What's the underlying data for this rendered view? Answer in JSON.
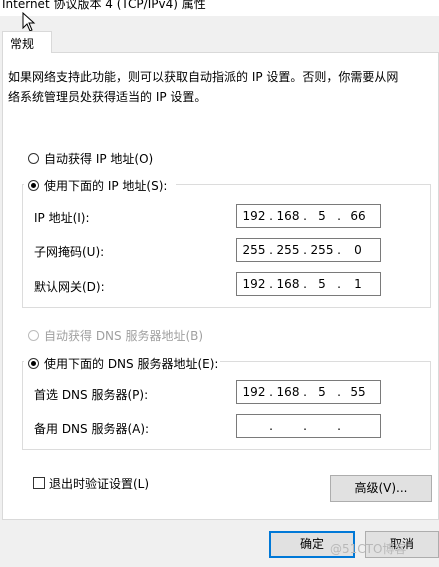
{
  "window": {
    "title": "Internet 协议版本 4 (TCP/IPv4) 属性"
  },
  "tabs": [
    {
      "label": "常规"
    }
  ],
  "description": "如果网络支持此功能，则可以获取自动指派的 IP 设置。否则，你需要从网\n络系统管理员处获得适当的 IP 设置。",
  "ip_section": {
    "auto_label": "自动获得 IP 地址(O)",
    "manual_label": "使用下面的 IP 地址(S):",
    "selected": "manual",
    "fields": [
      {
        "label": "IP 地址(I):",
        "octets": [
          "192",
          "168",
          "5",
          "66"
        ]
      },
      {
        "label": "子网掩码(U):",
        "octets": [
          "255",
          "255",
          "255",
          "0"
        ]
      },
      {
        "label": "默认网关(D):",
        "octets": [
          "192",
          "168",
          "5",
          "1"
        ]
      }
    ]
  },
  "dns_section": {
    "auto_label": "自动获得 DNS 服务器地址(B)",
    "manual_label": "使用下面的 DNS 服务器地址(E):",
    "selected": "manual",
    "fields": [
      {
        "label": "首选 DNS 服务器(P):",
        "octets": [
          "192",
          "168",
          "5",
          "55"
        ]
      },
      {
        "label": "备用 DNS 服务器(A):",
        "octets": [
          "",
          "",
          "",
          ""
        ]
      }
    ]
  },
  "validate_checkbox": {
    "label": "退出时验证设置(L)",
    "checked": false
  },
  "buttons": {
    "advanced": "高级(V)...",
    "ok": "确定",
    "cancel": "取消"
  },
  "watermark": "@51CTO博客",
  "colors": {
    "primary_button_border": "#0078d7",
    "disabled_text": "#a0a0a0"
  },
  "icons": {
    "cursor": "mouse-pointer-icon"
  }
}
